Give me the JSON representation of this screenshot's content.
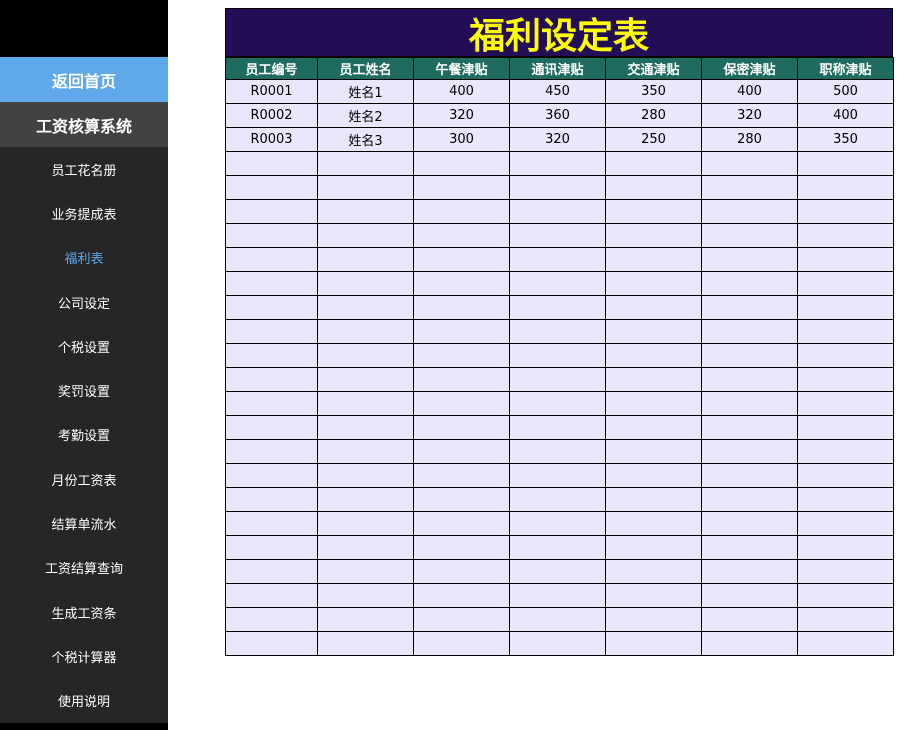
{
  "sidebar": {
    "home_label": "返回首页",
    "system_title": "工资核算系统",
    "items": [
      {
        "label": "员工花名册",
        "active": false
      },
      {
        "label": "业务提成表",
        "active": false
      },
      {
        "label": "福利表",
        "active": true
      },
      {
        "label": "公司设定",
        "active": false
      },
      {
        "label": "个税设置",
        "active": false
      },
      {
        "label": "奖罚设置",
        "active": false
      },
      {
        "label": "考勤设置",
        "active": false
      },
      {
        "label": "月份工资表",
        "active": false
      },
      {
        "label": "结算单流水",
        "active": false
      },
      {
        "label": "工资结算查询",
        "active": false
      },
      {
        "label": "生成工资条",
        "active": false
      },
      {
        "label": "个税计算器",
        "active": false
      },
      {
        "label": "使用说明",
        "active": false
      }
    ]
  },
  "sheet": {
    "title": "福利设定表",
    "columns": [
      "员工编号",
      "员工姓名",
      "午餐津贴",
      "通讯津贴",
      "交通津贴",
      "保密津贴",
      "职称津贴"
    ],
    "rows": [
      [
        "R0001",
        "姓名1",
        "400",
        "450",
        "350",
        "400",
        "500"
      ],
      [
        "R0002",
        "姓名2",
        "320",
        "360",
        "280",
        "320",
        "400"
      ],
      [
        "R0003",
        "姓名3",
        "300",
        "320",
        "250",
        "280",
        "350"
      ]
    ]
  },
  "colors": {
    "home_button": "#5fa8ea",
    "active_item": "#5fa8ea",
    "title_background": "#230d57",
    "title_text": "#ffff00",
    "header_background": "#1f6b5f",
    "cell_background": "#ece6fd"
  }
}
